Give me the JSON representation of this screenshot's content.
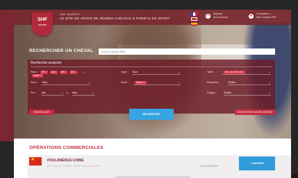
{
  "header": {
    "logo_main": "SHF",
    "logo_sub": "market",
    "brand_line1": "SHF MARKET",
    "brand_line2": "LE SITE DE VENTE DE JEUNES CHEVAUX & PONEYS DE SPORT",
    "link_deposit_line1": "Déposer",
    "link_deposit_line2": "une annonce",
    "link_login_line1": "Connectez-v",
    "link_login_line2": "Mon Compte SHF"
  },
  "search": {
    "title": "RECHERCHER UN CHEVAL",
    "placeholder": "Nom du Cheval, Père...",
    "advanced_title": "Recherche avancée",
    "race_label": "Race :",
    "race_chips": [
      "SF ×",
      "AA ×",
      "AR ×",
      "KS ×",
      "arpète ×"
    ],
    "type_label": "Type :",
    "type_value": "Tous",
    "taille_label": "Taille :",
    "taille_chip": "161 cm à 170 cm ×",
    "sexe_label": "Sexe :",
    "sexe_value": "Tous",
    "robe_label": "Robe :",
    "robe_chip": "Alezan ×",
    "discipline_label": "Discipline :",
    "discipline_value": "Toutes",
    "prix_label": "Prix :",
    "prix_min": "Min",
    "prix_sep": "à",
    "prix_max": "Max",
    "region_label": "Région :",
    "region_value": "Toutes",
    "reset_button": "RÉINITIALISER",
    "search_button": "RECHERCHER",
    "save_button": "ENREGISTRER MA RECHERCHE"
  },
  "operations": {
    "title": "OPÉRATIONS COMMERCIALES",
    "item_name": "POULINIÈRES CHINE",
    "item_sub": "DU 10 AU 15 OCTOBRE - DÉPÔT DES ANNONCES",
    "item_search": "Q RECHERCHER",
    "item_button": "+ INSCRIRE"
  }
}
